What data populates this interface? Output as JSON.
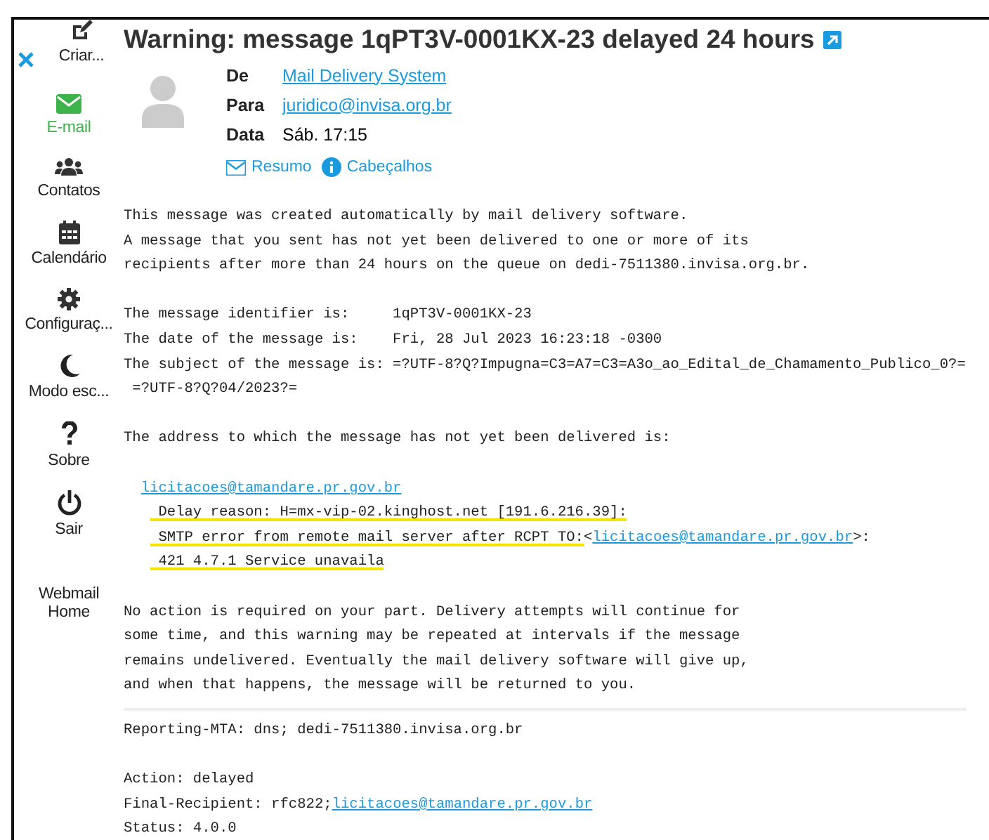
{
  "sidebar": {
    "items": [
      {
        "kind": "compose",
        "label": "Criar...",
        "selected": false
      },
      {
        "kind": "envelope",
        "label": "E-mail",
        "selected": true
      },
      {
        "kind": "users",
        "label": "Contatos",
        "selected": false
      },
      {
        "kind": "calendar",
        "label": "Calendário",
        "selected": false
      },
      {
        "kind": "gear",
        "label": "Configuraç...",
        "selected": false
      },
      {
        "kind": "moon",
        "label": "Modo esc...",
        "selected": false
      },
      {
        "kind": "question",
        "label": "Sobre",
        "selected": false
      },
      {
        "kind": "power",
        "label": "Sair",
        "selected": false
      },
      {
        "kind": "home",
        "label": "Webmail Home",
        "selected": false
      }
    ]
  },
  "message": {
    "subject": "Warning: message 1qPT3V-0001KX-23 delayed 24 hours",
    "headers": [
      {
        "label": "De",
        "value": "Mail Delivery System",
        "link": true
      },
      {
        "label": "Para",
        "value": "juridico@invisa.org.br",
        "link": true
      },
      {
        "label": "Data",
        "value": "Sáb. 17:15",
        "link": false
      }
    ],
    "views": [
      {
        "kind": "envelope",
        "label": "Resumo"
      },
      {
        "kind": "info",
        "label": "Cabeçalhos"
      }
    ],
    "body": [
      [
        [
          {
            "kind": "plain",
            "segments": [
              {
                "kind": "text",
                "text": "This message was created automatically by mail delivery software.",
                "highlighted": false
              }
            ]
          },
          {
            "kind": "plain",
            "segments": [
              {
                "kind": "text",
                "text": "A message that you sent has not yet been delivered to one or more of its",
                "highlighted": false
              }
            ]
          },
          {
            "kind": "plain",
            "segments": [
              {
                "kind": "text",
                "text": "recipients after more than 24 hours on the queue on dedi-7511380.invisa.org.br.",
                "highlighted": false
              }
            ]
          }
        ],
        [
          {
            "kind": "plain",
            "segments": [
              {
                "kind": "text",
                "text": "The message identifier is:     1qPT3V-0001KX-23",
                "highlighted": false
              }
            ]
          },
          {
            "kind": "plain",
            "segments": [
              {
                "kind": "text",
                "text": "The date of the message is:    Fri, 28 Jul 2023 16:23:18 -0300",
                "highlighted": false
              }
            ]
          },
          {
            "kind": "plain",
            "segments": [
              {
                "kind": "text",
                "text": "The subject of the message is: =?UTF-8?Q?Impugna=C3=A7=C3=A3o_ao_Edital_de_Chamamento_Publico_0?=",
                "highlighted": false
              }
            ]
          },
          {
            "kind": "plain",
            "segments": [
              {
                "kind": "text",
                "text": " =?UTF-8?Q?04/2023?=",
                "highlighted": false
              }
            ]
          }
        ],
        [
          {
            "kind": "plain",
            "segments": [
              {
                "kind": "text",
                "text": "The address to which the message has not yet been delivered is:",
                "highlighted": false
              }
            ]
          }
        ],
        [
          {
            "kind": "address",
            "segments": [
              {
                "kind": "link",
                "text": "licitacoes@tamandare.pr.gov.br",
                "highlighted": false
              }
            ]
          },
          {
            "kind": "detail",
            "segments": [
              {
                "kind": "text",
                "text": " Delay reason: H=mx-vip-02.kinghost.net [191.6.216.39]:",
                "highlighted": true
              }
            ]
          },
          {
            "kind": "detail",
            "segments": [
              {
                "kind": "text",
                "text": " SMTP error from remote mail server after RCPT TO:",
                "highlighted": true
              },
              {
                "kind": "text",
                "text": "<",
                "highlighted": false
              },
              {
                "kind": "link",
                "text": "licitacoes@tamandare.pr.gov.br",
                "highlighted": false
              },
              {
                "kind": "text",
                "text": ">:",
                "highlighted": false
              }
            ]
          },
          {
            "kind": "detail",
            "segments": [
              {
                "kind": "text",
                "text": " 421 4.7.1 Service unavaila",
                "highlighted": true
              }
            ]
          }
        ],
        [
          {
            "kind": "plain",
            "segments": [
              {
                "kind": "text",
                "text": "No action is required on your part. Delivery attempts will continue for",
                "highlighted": false
              }
            ]
          },
          {
            "kind": "plain",
            "segments": [
              {
                "kind": "text",
                "text": "some time, and this warning may be repeated at intervals if the message",
                "highlighted": false
              }
            ]
          },
          {
            "kind": "plain",
            "segments": [
              {
                "kind": "text",
                "text": "remains undelivered. Eventually the mail delivery software will give up,",
                "highlighted": false
              }
            ]
          },
          {
            "kind": "plain",
            "segments": [
              {
                "kind": "text",
                "text": "and when that happens, the message will be returned to you.",
                "highlighted": false
              }
            ]
          }
        ]
      ],
      [
        [
          {
            "kind": "plain",
            "segments": [
              {
                "kind": "text",
                "text": "Reporting-MTA: dns; dedi-7511380.invisa.org.br",
                "highlighted": false
              }
            ]
          }
        ],
        [
          {
            "kind": "plain",
            "segments": [
              {
                "kind": "text",
                "text": "Action: delayed",
                "highlighted": false
              }
            ]
          },
          {
            "kind": "plain",
            "segments": [
              {
                "kind": "text",
                "text": "Final-Recipient: rfc822;",
                "highlighted": false
              },
              {
                "kind": "link",
                "text": "licitacoes@tamandare.pr.gov.br",
                "highlighted": false
              }
            ]
          },
          {
            "kind": "plain",
            "segments": [
              {
                "kind": "text",
                "text": "Status: 4.0.0",
                "highlighted": false
              }
            ]
          }
        ]
      ]
    ]
  }
}
